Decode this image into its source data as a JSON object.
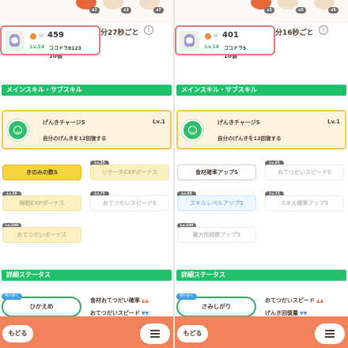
{
  "panels": [
    {
      "ingredient_counts": [
        "x2",
        "x2",
        "x7"
      ],
      "popup": {
        "sp_label": "SP",
        "sp_value": "459",
        "level": "Lv.14",
        "name": "ココドラ8123"
      },
      "interval": "分27秒ごと",
      "info_icon": "i",
      "under_value": "10個",
      "main_skill_header": "メインスキル・サブスキル",
      "main_skill": {
        "name": "げんきチャージS",
        "level": "Lv.1",
        "description": "自分のげんきを12回復する"
      },
      "sub_skills": [
        {
          "label": "きのみの数S",
          "level_tag": ""
        },
        {
          "label": "リサーチEXPボーナス",
          "level_tag": "Lv.25"
        },
        {
          "label": "睡眠EXPボーナス",
          "level_tag": "Lv.50"
        },
        {
          "label": "おてつだいスピードS",
          "level_tag": "Lv.75"
        },
        {
          "label": "おてつだいボーナス",
          "level_tag": "Lv.100"
        }
      ],
      "stats_header": "詳細ステータス",
      "nature_tag": "せいかく",
      "nature": "ひかえめ",
      "stat_lines": [
        {
          "label": "食材おてつだい確率",
          "arrows": "▲▲",
          "dir": "up"
        },
        {
          "label": "おてつだいスピード",
          "arrows": "▼▼",
          "dir": "down"
        }
      ],
      "back_label": "もどる"
    },
    {
      "ingredient_counts": [
        "x2",
        "x5",
        "x5"
      ],
      "popup": {
        "sp_label": "SP",
        "sp_value": "401",
        "level": "Lv.14",
        "name": "ココドラ5"
      },
      "interval": "分16秒ごと",
      "info_icon": "i",
      "under_value": "10個",
      "main_skill_header": "メインスキル・サブスキル",
      "main_skill": {
        "name": "げんきチャージS",
        "level": "Lv.1",
        "description": "自分のげんきを12回復する"
      },
      "sub_skills": [
        {
          "label": "食材確率アップS",
          "level_tag": ""
        },
        {
          "label": "おてつだいスピードS",
          "level_tag": "Lv.25"
        },
        {
          "label": "スキルレベルアップS",
          "level_tag": "Lv.50"
        },
        {
          "label": "スキル確率アップS",
          "level_tag": "Lv.75"
        },
        {
          "label": "最大所持数アップS",
          "level_tag": "Lv.100"
        }
      ],
      "stats_header": "詳細ステータス",
      "nature_tag": "せいかく",
      "nature": "さみしがり",
      "stat_lines": [
        {
          "label": "おてつだいスピード",
          "arrows": "▲▲",
          "dir": "up"
        },
        {
          "label": "げんき回復量",
          "arrows": "▼▼",
          "dir": "down"
        }
      ],
      "back_label": "もどる"
    }
  ],
  "colors": {
    "section_green": "#22c06a",
    "bottom_bar": "#f2825a",
    "skill_card_border": "#f3c75a",
    "popup_border": "#e87a7a"
  }
}
